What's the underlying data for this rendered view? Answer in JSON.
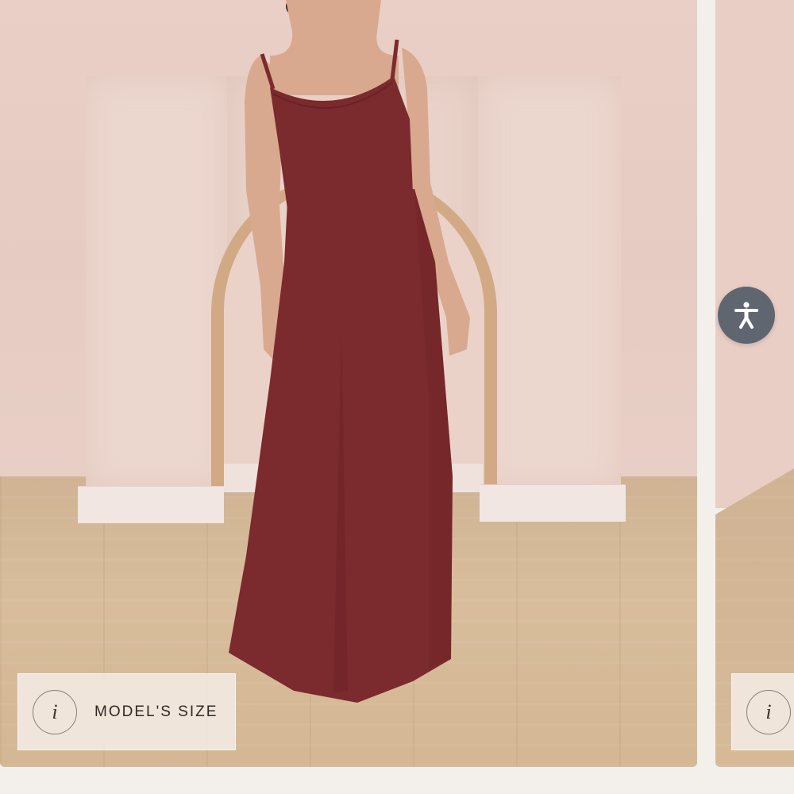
{
  "gallery": {
    "main_slide": {
      "image_alt": "Model wearing long burgundy cowl-neck spaghetti strap gown",
      "model_size_label": "MODEL'S SIZE",
      "info_icon_glyph": "i"
    },
    "next_slide": {
      "info_icon_glyph": "i"
    }
  },
  "accessibility": {
    "icon": "accessibility-person-icon",
    "color": "#5f6670"
  },
  "colors": {
    "dress": "#7b2a2d",
    "badge_background": "#f3ebe4",
    "page_background": "#f3f0ec"
  }
}
